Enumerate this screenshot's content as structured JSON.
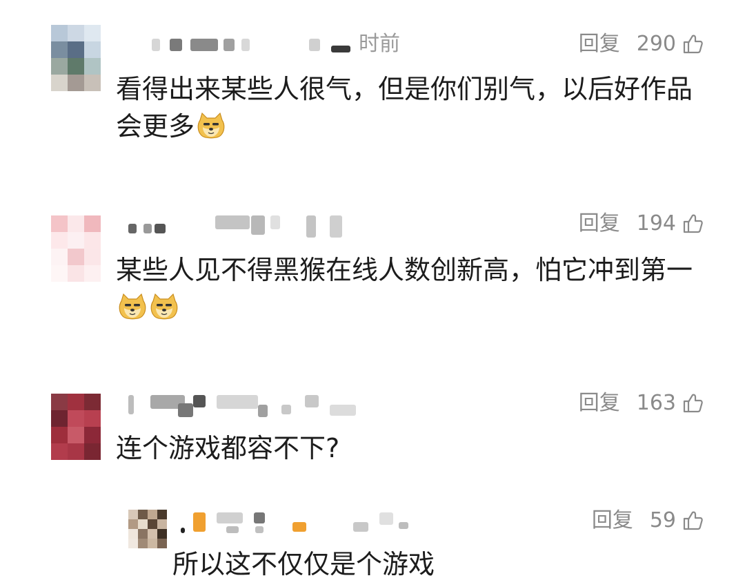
{
  "comments": [
    {
      "time": "时前",
      "reply_label": "回复",
      "likes": "290",
      "text": "看得出来某些人很气，但是你们别气，以后好作品会更多",
      "emojis": 1,
      "avatar_colors": [
        "#b8c8d8",
        "#cdd8e4",
        "#dfe8f0",
        "#7a8ea0",
        "#5a6e86",
        "#c8d6e2",
        "#9aa8a0",
        "#5f7a6a",
        "#b0c4c4",
        "#d8d4cc",
        "#a49a94",
        "#c8c0b8"
      ]
    },
    {
      "reply_label": "回复",
      "likes": "194",
      "text": "某些人见不得黑猴在线人数创新高，怕它冲到第一",
      "emojis": 2,
      "avatar_colors": [
        "#f4c4c8",
        "#fbe8ea",
        "#f0b8bd",
        "#fde8ea",
        "#fcf0f2",
        "#fce6e8",
        "#fdf3f4",
        "#f2c8cc",
        "#fbe6e8",
        "#fef6f6",
        "#fae4e6",
        "#fdf0f1"
      ]
    },
    {
      "reply_label": "回复",
      "likes": "163",
      "text": "连个游戏都容不下?",
      "emojis": 0,
      "avatar_colors": [
        "#8a3a44",
        "#a0313f",
        "#7c2a34",
        "#6e2430",
        "#c04a5a",
        "#b84050",
        "#9e2e3c",
        "#c85a68",
        "#8c2838",
        "#b23c4c",
        "#a83646",
        "#7a2632"
      ]
    },
    {
      "reply_label": "回复",
      "likes": "59",
      "text": "所以这不仅仅是个游戏",
      "emojis": 0,
      "avatar_colors": [
        "#d8c8b8",
        "#6e5a48",
        "#c0a890",
        "#4a3a2c",
        "#b29a84",
        "#e8dccc",
        "#5a4636",
        "#c8b4a0",
        "#efe6dc",
        "#8a7462",
        "#d4c0ac",
        "#3e3024",
        "#f0e8e0",
        "#a08a76",
        "#ccb8a2",
        "#7a6452"
      ]
    }
  ]
}
